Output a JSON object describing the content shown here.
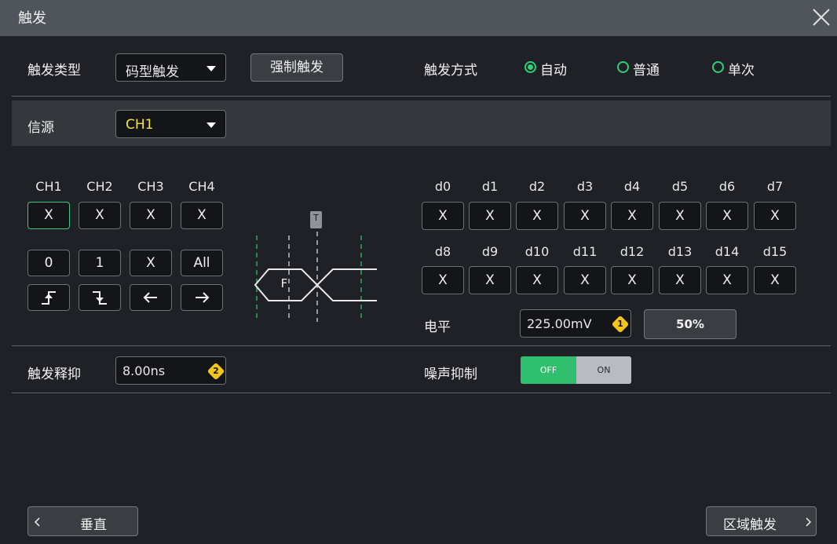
{
  "window": {
    "title": "触发"
  },
  "trigger_type": {
    "label": "触发类型",
    "value": "码型触发"
  },
  "force_button": "强制触发",
  "trigger_mode": {
    "label": "触发方式",
    "options": [
      {
        "label": "自动",
        "selected": true
      },
      {
        "label": "普通",
        "selected": false
      },
      {
        "label": "单次",
        "selected": false
      }
    ]
  },
  "source": {
    "label": "信源",
    "value": "CH1",
    "value_color": "#f5e142"
  },
  "channels": {
    "labels": [
      "CH1",
      "CH2",
      "CH3",
      "CH4"
    ],
    "values": [
      "X",
      "X",
      "X",
      "X"
    ],
    "active_index": 0
  },
  "pattern_keys": {
    "row1": [
      "0",
      "1",
      "X",
      "All"
    ],
    "row2_icons": [
      "rising-edge-icon",
      "falling-edge-icon",
      "arrow-left-icon",
      "arrow-right-icon"
    ],
    "row2_glyphs": [
      "⭍",
      "⭏",
      "←",
      "→"
    ]
  },
  "diagram": {
    "marker": "T",
    "pattern_label": "F"
  },
  "digital": {
    "row1_labels": [
      "d0",
      "d1",
      "d2",
      "d3",
      "d4",
      "d5",
      "d6",
      "d7"
    ],
    "row1_values": [
      "X",
      "X",
      "X",
      "X",
      "X",
      "X",
      "X",
      "X"
    ],
    "row2_labels": [
      "d8",
      "d9",
      "d10",
      "d11",
      "d12",
      "d13",
      "d14",
      "d15"
    ],
    "row2_values": [
      "X",
      "X",
      "X",
      "X",
      "X",
      "X",
      "X",
      "X"
    ]
  },
  "level": {
    "label": "电平",
    "value": "225.00mV",
    "badge": "1",
    "percent_button": "50%"
  },
  "holdoff": {
    "label": "触发释抑",
    "value": "8.00ns",
    "badge": "2"
  },
  "noise_reject": {
    "label": "噪声抑制",
    "off": "OFF",
    "on": "ON",
    "state": "OFF"
  },
  "nav": {
    "prev": "垂直",
    "next": "区域触发"
  },
  "colors": {
    "accent": "#2fd07a",
    "badge": "#f5c518",
    "toggle_off_bg": "#2fbf6f"
  }
}
